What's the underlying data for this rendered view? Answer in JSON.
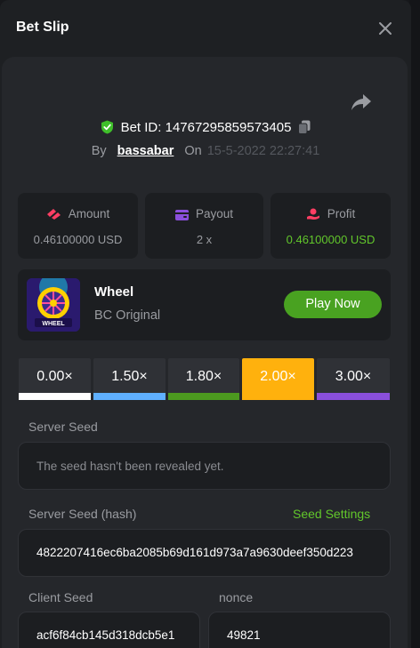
{
  "modal": {
    "title": "Bet Slip"
  },
  "bet": {
    "id_label": "Bet ID: 14767295859573405",
    "by": "By",
    "user": "bassabar",
    "on": "On",
    "date": "15-5-2022 22:27:41"
  },
  "stats": [
    {
      "label": "Amount",
      "value": "0.46100000 USD"
    },
    {
      "label": "Payout",
      "value": "2 x"
    },
    {
      "label": "Profit",
      "value": "0.46100000 USD"
    }
  ],
  "game": {
    "name": "Wheel",
    "subtitle": "BC Original",
    "play_label": "Play Now",
    "thumb_text": "WHEEL"
  },
  "multipliers": [
    {
      "label": "0.00×",
      "color": "#ffffff",
      "selected": false
    },
    {
      "label": "1.50×",
      "color": "#5fb0ff",
      "selected": false
    },
    {
      "label": "1.80×",
      "color": "#4c9a1f",
      "selected": false
    },
    {
      "label": "2.00×",
      "color": "#ffb10d",
      "selected": true
    },
    {
      "label": "3.00×",
      "color": "#8a4fdb",
      "selected": false
    }
  ],
  "seeds": {
    "server_label": "Server Seed",
    "server_placeholder": "The seed hasn't been revealed yet.",
    "hash_label": "Server Seed (hash)",
    "settings_link": "Seed Settings",
    "hash_value": "4822207416ec6ba2085b69d161d973a7a9630deef350d223",
    "client_label": "Client Seed",
    "client_value": "acf6f84cb145d318dcb5e1",
    "nonce_label": "nonce",
    "nonce_value": "49821"
  },
  "colors": {
    "accent_green": "#62c72b",
    "button_green": "#49a221",
    "selected": "#ffb10d"
  }
}
